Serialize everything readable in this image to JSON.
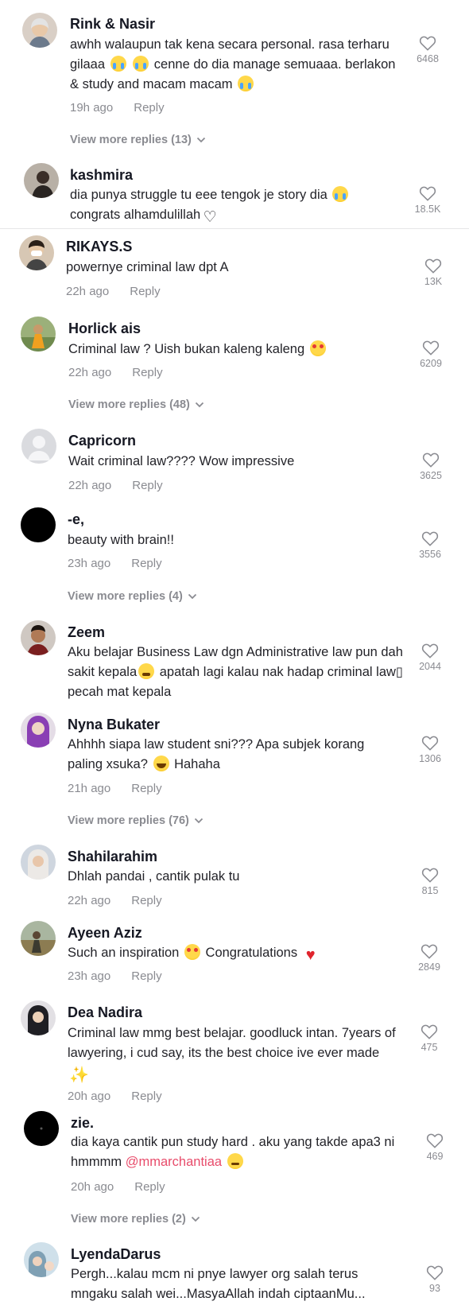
{
  "comments": [
    {
      "user": "Rink & Nasir",
      "text_parts": [
        "awhh walaupun tak kena secara personal. rasa terharu gilaaa ",
        " ",
        " cenne do dia manage semuaaa. berlakon & study and macam macam ",
        ""
      ],
      "time": "19h ago",
      "reply": "Reply",
      "likes": "6468",
      "more": "View more replies (13)"
    },
    {
      "user": "kashmira",
      "text_parts": [
        "dia punya struggle tu eee tengok je story dia ",
        " congrats alhamdulillah",
        ""
      ],
      "likes": "18.5K"
    },
    {
      "user": "RIKAYS.S",
      "text": "powernye criminal law dpt A",
      "time": "22h ago",
      "reply": "Reply",
      "likes": "13K"
    },
    {
      "user": "Horlick ais",
      "text_parts": [
        "Criminal law ? Uish bukan kaleng kaleng ",
        ""
      ],
      "time": "22h ago",
      "reply": "Reply",
      "likes": "6209",
      "more": "View more replies (48)"
    },
    {
      "user": "Capricorn",
      "text": "Wait criminal law???? Wow impressive",
      "time": "22h ago",
      "reply": "Reply",
      "likes": "3625"
    },
    {
      "user": "-e,",
      "text": "beauty with brain!!",
      "time": "23h ago",
      "reply": "Reply",
      "likes": "3556",
      "more": "View more replies (4)"
    },
    {
      "user": "Zeem",
      "text_parts": [
        "Aku belajar Business Law dgn Administrative law pun dah sakit kepala",
        " apatah lagi kalau nak hadap criminal law▯ pecah mat kepala"
      ],
      "likes": "2044"
    },
    {
      "user": "Nyna Bukater",
      "text_parts": [
        "Ahhhh siapa law student sni??? Apa subjek korang paling xsuka? ",
        " Hahaha"
      ],
      "time": "21h ago",
      "reply": "Reply",
      "likes": "1306",
      "more": "View more replies (76)"
    },
    {
      "user": "Shahilarahim",
      "text": "Dhlah pandai , cantik pulak tu",
      "time": "22h ago",
      "reply": "Reply",
      "likes": "815"
    },
    {
      "user": "Ayeen Aziz",
      "text_parts": [
        "Such an inspiration ",
        " Congratulations ",
        ""
      ],
      "time": "23h ago",
      "reply": "Reply",
      "likes": "2849"
    },
    {
      "user": "Dea Nadira",
      "text_parts": [
        "Criminal law mmg best belajar. goodluck intan. 7years of lawyering, i cud say, its the best choice ive ever made",
        ""
      ],
      "time": "20h ago",
      "reply": "Reply",
      "likes": "475"
    },
    {
      "user": "zie.",
      "text_parts": [
        "dia kaya cantik pun study hard . aku yang takde apa3 ni hmmmm ",
        "@mmarchantiaa",
        " ",
        ""
      ],
      "time": "20h ago",
      "reply": "Reply",
      "likes": "469",
      "more": "View more replies (2)"
    },
    {
      "user": "LyendaDarus",
      "text": "Pergh...kalau mcm ni pnye lawyer org salah terus mngaku salah wei...MasyaAllah indah ciptaanMu...",
      "likes": "93"
    }
  ],
  "icons": {
    "like": "heart-outline-icon",
    "chevron": "chevron-down-icon"
  },
  "colors": {
    "text": "#161823",
    "muted": "#8a8b91",
    "mention": "#e84c6b"
  }
}
